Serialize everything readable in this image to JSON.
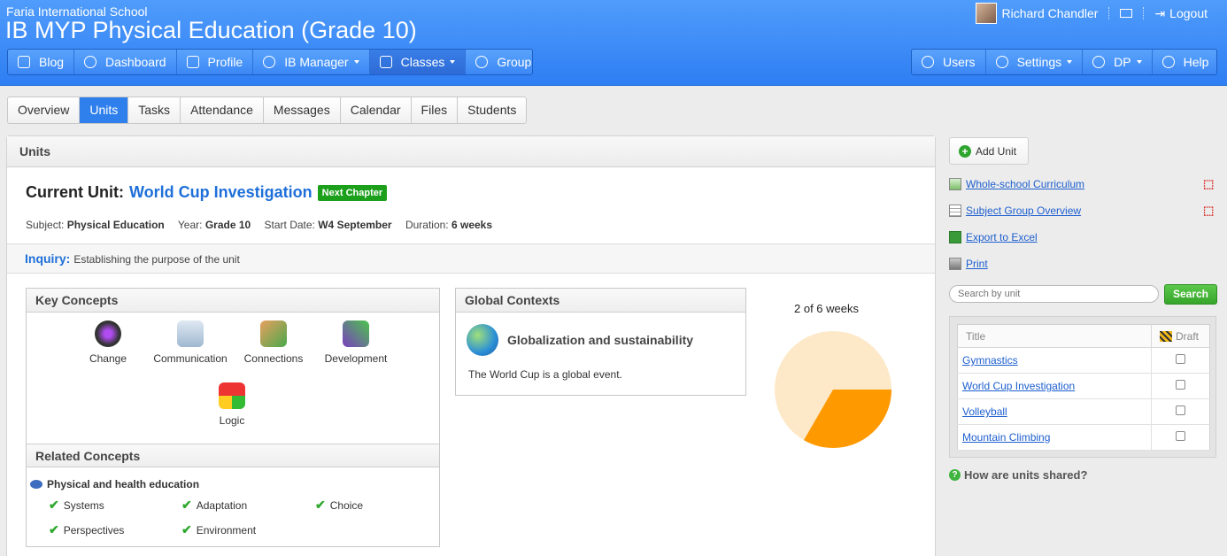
{
  "header": {
    "school": "Faria International School",
    "title": "IB MYP Physical Education (Grade 10)",
    "user_name": "Richard Chandler",
    "logout_label": "Logout"
  },
  "nav_left": [
    {
      "label": "Blog",
      "icon": "blog-icon"
    },
    {
      "label": "Dashboard",
      "icon": "dashboard-icon"
    },
    {
      "label": "Profile",
      "icon": "profile-icon"
    },
    {
      "label": "IB Manager",
      "icon": "globe-icon"
    },
    {
      "label": "Classes",
      "icon": "classes-icon"
    },
    {
      "label": "Groups",
      "icon": "trophy-icon"
    }
  ],
  "nav_right": [
    {
      "label": "Users",
      "icon": "user-icon"
    },
    {
      "label": "Settings",
      "icon": "gear-icon"
    },
    {
      "label": "DP",
      "icon": "search-icon"
    },
    {
      "label": "Help",
      "icon": "help-icon"
    }
  ],
  "tabs": [
    "Overview",
    "Units",
    "Tasks",
    "Attendance",
    "Messages",
    "Calendar",
    "Files",
    "Students"
  ],
  "panel": {
    "title": "Units",
    "current_unit_label": "Current Unit:",
    "current_unit": "World Cup Investigation",
    "badge": "Next Chapter",
    "subject_label": "Subject:",
    "subject": "Physical Education",
    "year_label": "Year:",
    "year": "Grade 10",
    "start_label": "Start Date:",
    "start": "W4 September",
    "duration_label": "Duration:",
    "duration": "6 weeks",
    "inquiry_label": "Inquiry:",
    "inquiry_text": "Establishing the purpose of the unit"
  },
  "key_concepts": {
    "title": "Key Concepts",
    "items": [
      "Change",
      "Communication",
      "Connections",
      "Development",
      "Logic"
    ]
  },
  "related_concepts": {
    "title": "Related Concepts",
    "category": "Physical and health education",
    "items": [
      "Systems",
      "Adaptation",
      "Choice",
      "Perspectives",
      "Environment"
    ]
  },
  "global_contexts": {
    "title": "Global Contexts",
    "context": "Globalization and sustainability",
    "description": "The World Cup is a global event."
  },
  "progress": {
    "label": "2 of 6 weeks",
    "done_weeks": 2,
    "total_weeks": 6,
    "color_done": "#ff9900",
    "color_remaining": "#fde8c8"
  },
  "sidebar": {
    "add_unit": "Add Unit",
    "links": [
      "Whole-school Curriculum",
      "Subject Group Overview",
      "Export to Excel",
      "Print"
    ],
    "search_placeholder": "Search by unit",
    "search_button": "Search",
    "table_headers": {
      "title": "Title",
      "draft": "Draft"
    },
    "units": [
      "Gymnastics",
      "World Cup Investigation",
      "Volleyball",
      "Mountain Climbing"
    ],
    "help_text": "How are units shared?"
  }
}
